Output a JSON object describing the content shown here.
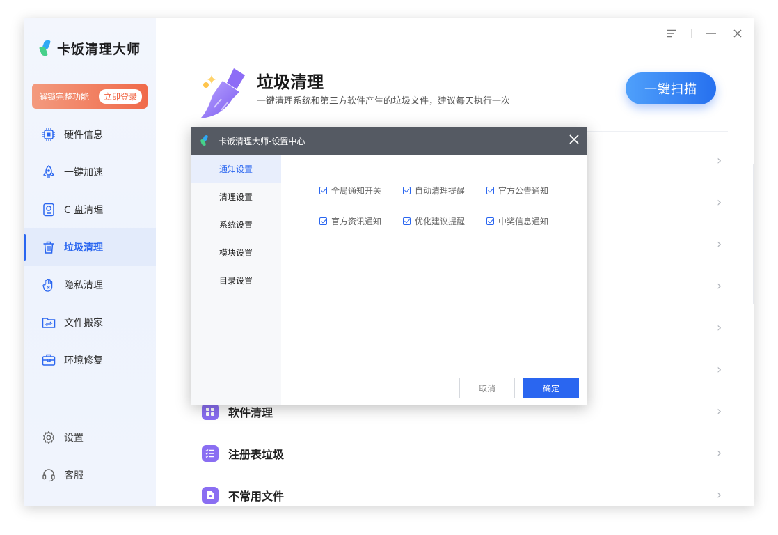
{
  "app": {
    "title": "卡饭清理大师"
  },
  "promo": {
    "text": "解锁完整功能",
    "button": "立即登录"
  },
  "sidebar": {
    "items": [
      {
        "label": "硬件信息",
        "icon": "chip-icon"
      },
      {
        "label": "一键加速",
        "icon": "rocket-icon"
      },
      {
        "label": "C 盘清理",
        "icon": "disk-icon"
      },
      {
        "label": "垃圾清理",
        "icon": "trash-icon",
        "active": true
      },
      {
        "label": "隐私清理",
        "icon": "privacy-hand-icon"
      },
      {
        "label": "文件搬家",
        "icon": "folder-move-icon"
      },
      {
        "label": "环境修复",
        "icon": "toolbox-icon"
      }
    ],
    "bottom": [
      {
        "label": "设置",
        "icon": "gear-icon"
      },
      {
        "label": "客服",
        "icon": "headset-icon"
      }
    ]
  },
  "main": {
    "title": "垃圾清理",
    "subtitle": "一键清理系统和第三方软件产生的垃圾文件，建议每天执行一次",
    "scan_button": "一键扫描",
    "rows": [
      {
        "label": "软件清理",
        "icon": "apps-grid-icon"
      },
      {
        "label": "注册表垃圾",
        "icon": "list-check-icon"
      },
      {
        "label": "不常用文件",
        "icon": "file-icon"
      }
    ]
  },
  "dialog": {
    "title": "卡饭清理大师-设置中心",
    "tabs": [
      "通知设置",
      "清理设置",
      "系统设置",
      "模块设置",
      "目录设置"
    ],
    "active_tab": 0,
    "options": [
      {
        "label": "全局通知开关",
        "checked": true
      },
      {
        "label": "自动清理提醒",
        "checked": true
      },
      {
        "label": "官方公告通知",
        "checked": true
      },
      {
        "label": "官方资讯通知",
        "checked": true
      },
      {
        "label": "优化建议提醒",
        "checked": true
      },
      {
        "label": "中奖信息通知",
        "checked": true
      }
    ],
    "cancel": "取消",
    "ok": "确定"
  },
  "colors": {
    "accent": "#2a66f0",
    "promo": "#f06a4a",
    "dialog_header": "#555a63"
  }
}
